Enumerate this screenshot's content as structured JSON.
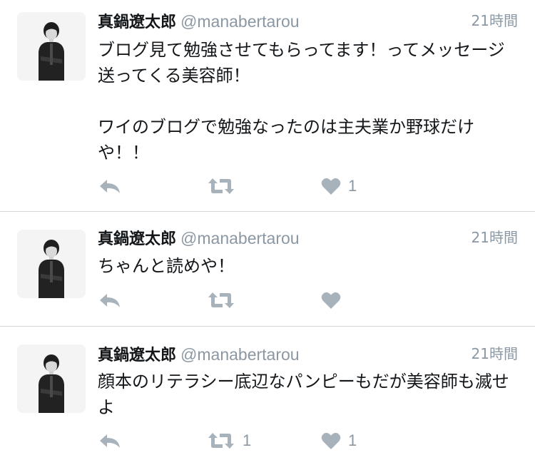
{
  "colors": {
    "text": "#14171a",
    "secondary": "#8b98a4",
    "icon": "#a8b2bb",
    "divider": "#d3d7db"
  },
  "icons": {
    "reply": "reply-arrow-icon",
    "retweet": "retweet-icon",
    "like": "heart-icon"
  },
  "tweets": [
    {
      "name": "真鍋遼太郎",
      "handle": "@manabertarou",
      "time": "21時間",
      "text": "ブログ見て勉強させてもらってます！ってメッセージ送ってくる美容師！\n\nワイのブログで勉強なったのは主夫業か野球だけや！！",
      "retweets": "",
      "likes": "1"
    },
    {
      "name": "真鍋遼太郎",
      "handle": "@manabertarou",
      "time": "21時間",
      "text": "ちゃんと読めや！",
      "retweets": "",
      "likes": ""
    },
    {
      "name": "真鍋遼太郎",
      "handle": "@manabertarou",
      "time": "21時間",
      "text": "顔本のリテラシー底辺なパンピーもだが美容師も滅せよ",
      "retweets": "1",
      "likes": "1"
    }
  ]
}
